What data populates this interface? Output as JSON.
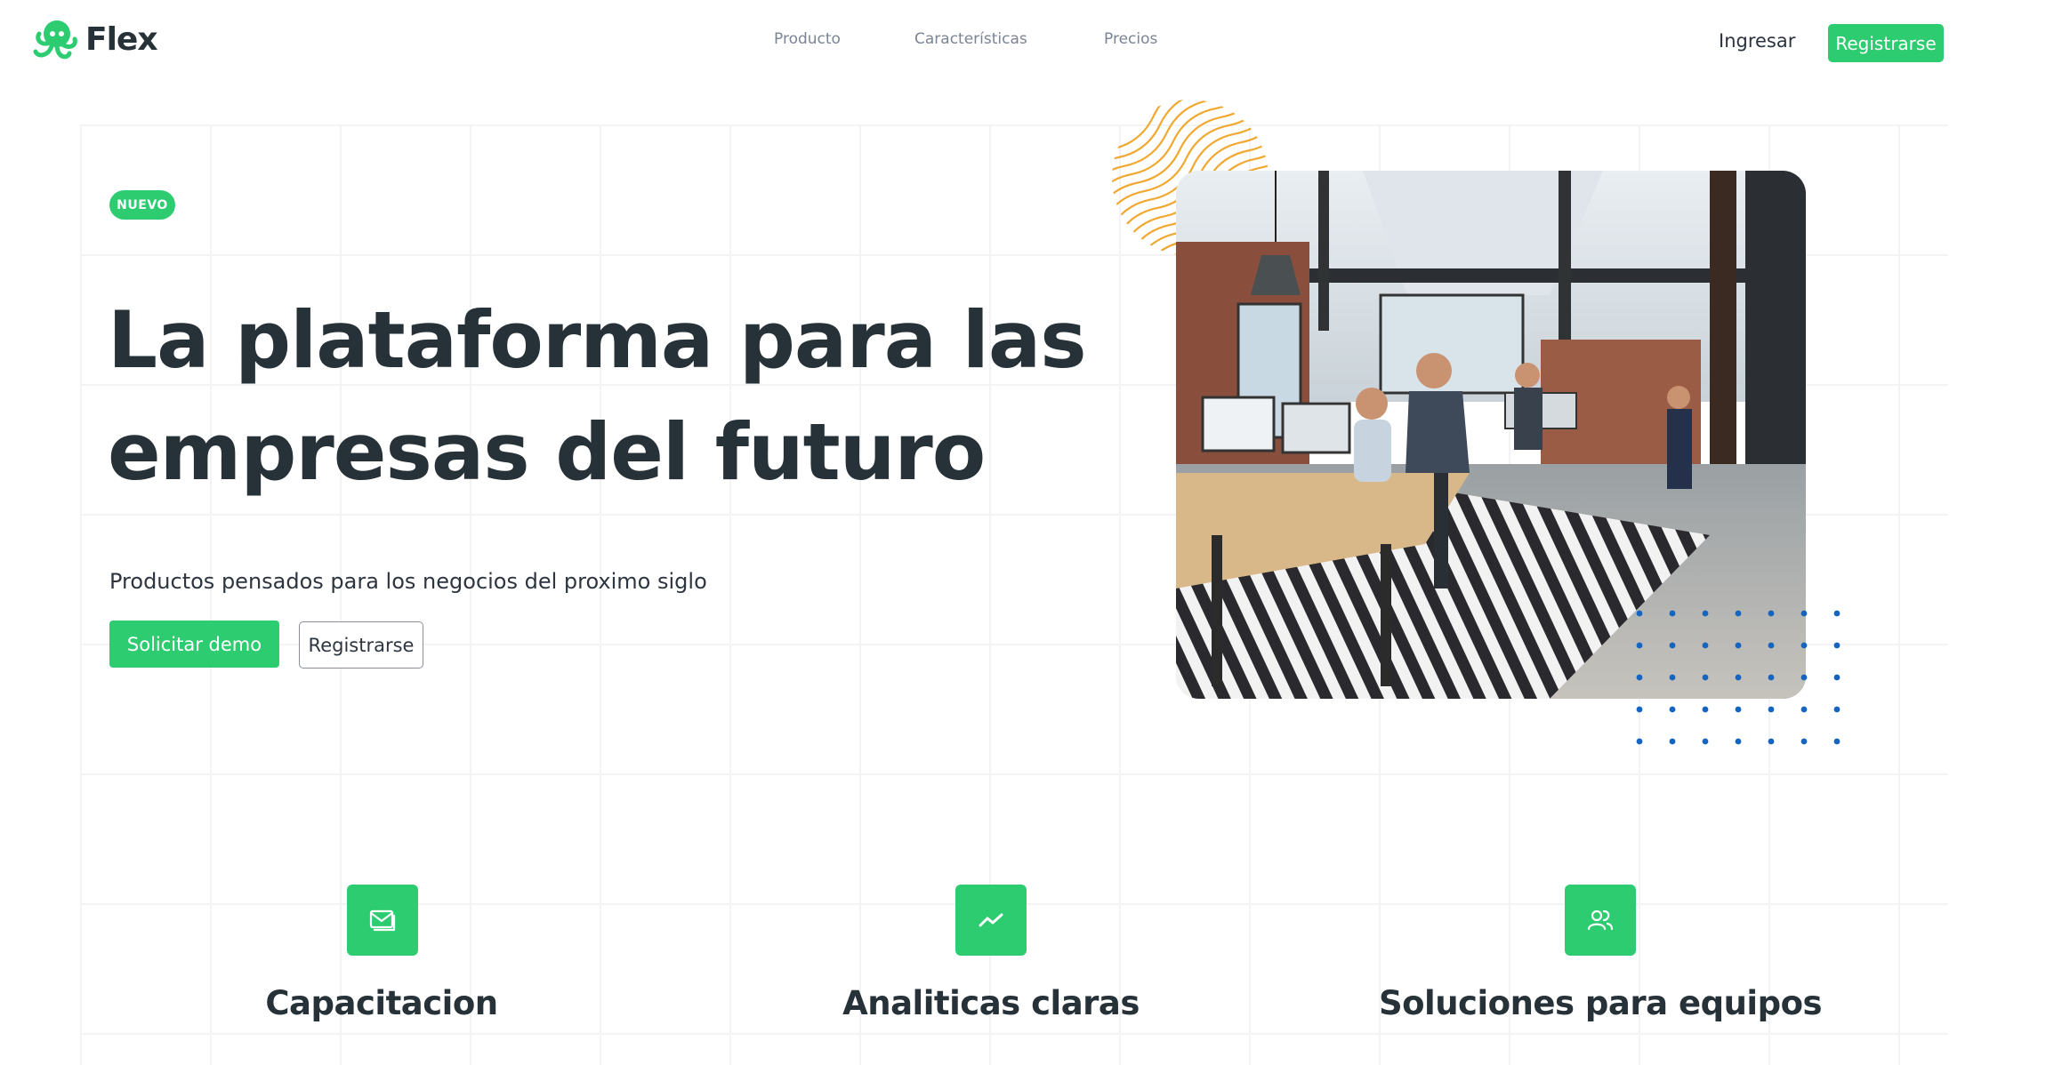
{
  "header": {
    "logo_text": "Flex",
    "nav": [
      {
        "label": "Producto"
      },
      {
        "label": "Características"
      },
      {
        "label": "Precios"
      }
    ],
    "login_label": "Ingresar",
    "signup_label": "Registrarse"
  },
  "hero": {
    "badge": "NUEVO",
    "title": "La plataforma para las empresas del futuro",
    "subtitle": "Productos pensados para los negocios del proximo siglo",
    "primary_button": "Solicitar demo",
    "secondary_button": "Registrarse"
  },
  "features": [
    {
      "icon": "mail-icon",
      "title": "Capacitacion"
    },
    {
      "icon": "trend-line-icon",
      "title": "Analiticas claras"
    },
    {
      "icon": "users-icon",
      "title": "Soluciones para equipos"
    }
  ],
  "colors": {
    "accent": "#2ecc71",
    "text_dark": "#263238",
    "nav_text": "#7a8494",
    "wave_deco": "#f0a830",
    "dot_deco": "#1565c0"
  }
}
